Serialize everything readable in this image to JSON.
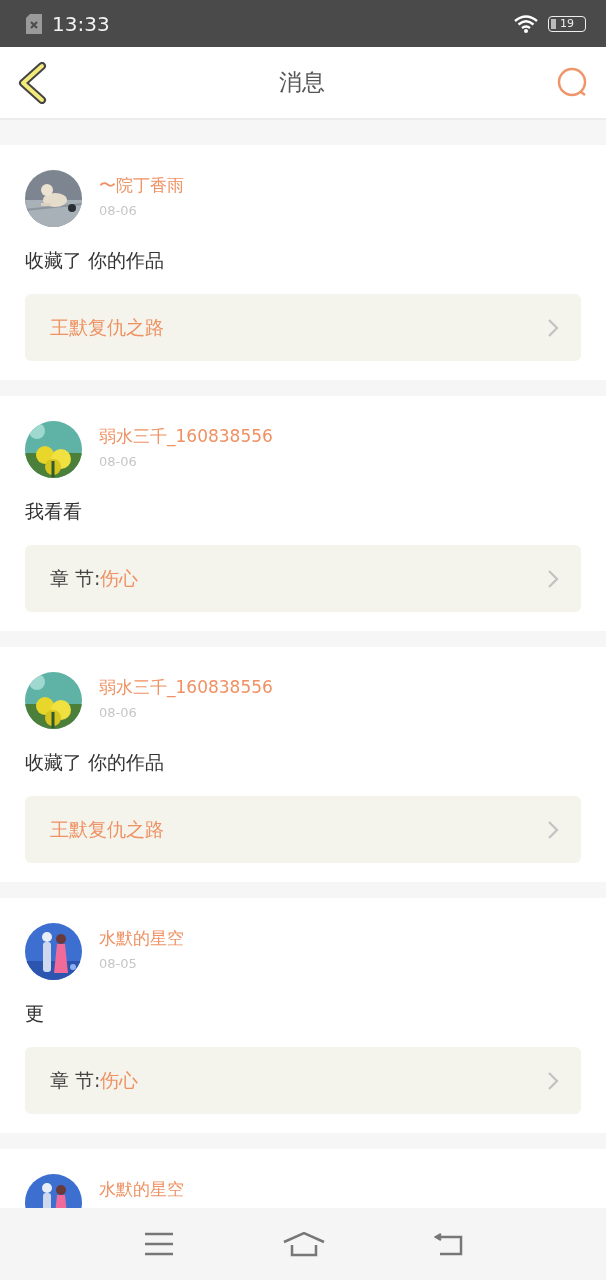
{
  "status_bar": {
    "time": "13:33",
    "battery": "19"
  },
  "header": {
    "title": "消息"
  },
  "messages": [
    {
      "name": "〜院丁香雨",
      "date": "08-06",
      "text": "收藏了 你的作品",
      "link": {
        "kind": "work",
        "title": "王默复仇之路"
      }
    },
    {
      "name": "弱水三千_160838556",
      "date": "08-06",
      "text": "我看看",
      "link": {
        "kind": "chapter",
        "prefix": "章 节:",
        "title": "伤心"
      }
    },
    {
      "name": "弱水三千_160838556",
      "date": "08-06",
      "text": "收藏了 你的作品",
      "link": {
        "kind": "work",
        "title": "王默复仇之路"
      }
    },
    {
      "name": "水默的星空",
      "date": "08-05",
      "text": "更",
      "link": {
        "kind": "chapter",
        "prefix": "章 节:",
        "title": "伤心"
      }
    },
    {
      "name": "水默的星空"
    }
  ]
}
